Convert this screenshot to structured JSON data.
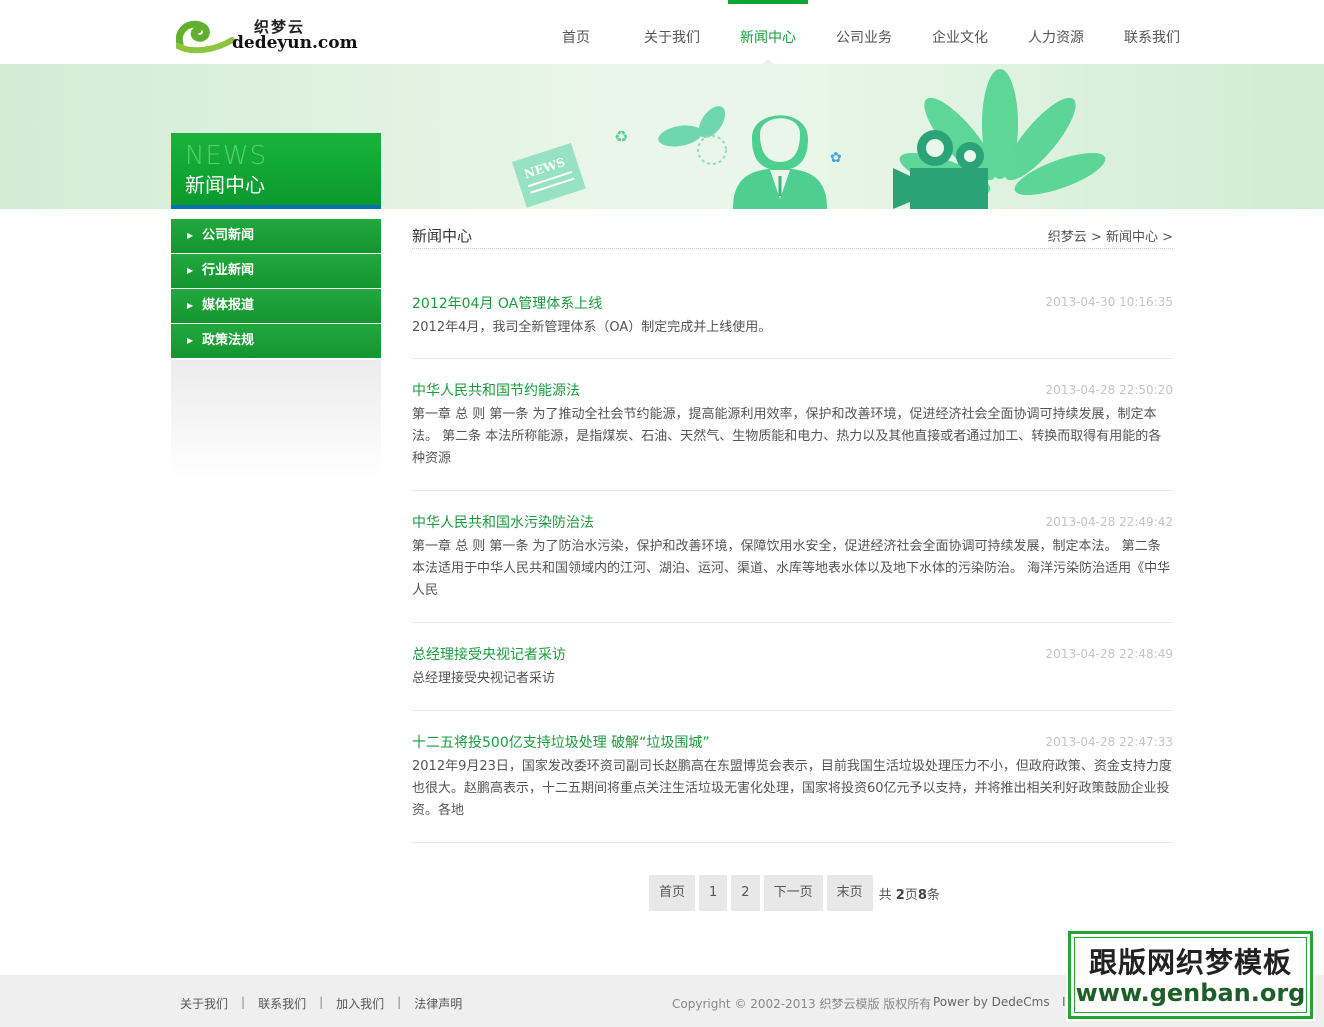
{
  "header": {
    "logo_cn": "织梦云",
    "logo_en": "dedeyun.com",
    "nav": [
      {
        "label": "首页",
        "active": false
      },
      {
        "label": "关于我们",
        "active": false
      },
      {
        "label": "新闻中心",
        "active": true
      },
      {
        "label": "公司业务",
        "active": false
      },
      {
        "label": "企业文化",
        "active": false
      },
      {
        "label": "人力资源",
        "active": false
      },
      {
        "label": "联系我们",
        "active": false
      }
    ]
  },
  "banner": {
    "en": "NEWS",
    "cn": "新闻中心",
    "paper_label": "NEWS"
  },
  "sidebar": {
    "items": [
      {
        "label": "公司新闻"
      },
      {
        "label": "行业新闻"
      },
      {
        "label": "媒体报道"
      },
      {
        "label": "政策法规"
      }
    ]
  },
  "content": {
    "title": "新闻中心",
    "breadcrumb": {
      "home": "织梦云",
      "sep": ">",
      "current": "新闻中心"
    }
  },
  "news": [
    {
      "title": "2012年04月 OA管理体系上线",
      "date": "2013-04-30 10:16:35",
      "desc": "2012年4月，我司全新管理体系（OA）制定完成并上线使用。"
    },
    {
      "title": "中华人民共和国节约能源法",
      "date": "2013-04-28 22:50:20",
      "desc": "第一章 总 则 第一条 为了推动全社会节约能源，提高能源利用效率，保护和改善环境，促进经济社会全面协调可持续发展，制定本法。 第二条 本法所称能源，是指煤炭、石油、天然气、生物质能和电力、热力以及其他直接或者通过加工、转换而取得有用能的各种资源"
    },
    {
      "title": "中华人民共和国水污染防治法",
      "date": "2013-04-28 22:49:42",
      "desc": "第一章 总 则 第一条 为了防治水污染，保护和改善环境，保障饮用水安全，促进经济社会全面协调可持续发展，制定本法。 第二条 本法适用于中华人民共和国领域内的江河、湖泊、运河、渠道、水库等地表水体以及地下水体的污染防治。 海洋污染防治适用《中华人民"
    },
    {
      "title": "总经理接受央视记者采访",
      "date": "2013-04-28 22:48:49",
      "desc": "总经理接受央视记者采访"
    },
    {
      "title": "十二五将投500亿支持垃圾处理 破解“垃圾围城”",
      "date": "2013-04-28 22:47:33",
      "desc": "2012年9月23日，国家发改委环资司副司长赵鹏高在东盟博览会表示，目前我国生活垃圾处理压力不小，但政府政策、资金支持力度也很大。赵鹏高表示，十二五期间将重点关注生活垃圾无害化处理，国家将投资60亿元予以支持，并将推出相关利好政策鼓励企业投资。各地"
    }
  ],
  "pager": {
    "first": "首页",
    "pages": [
      "1",
      "2"
    ],
    "next": "下一页",
    "last": "末页",
    "total_prefix": "共",
    "total_pages": "2",
    "total_mid": "页",
    "total_items": "8",
    "total_suffix": "条"
  },
  "footer": {
    "links": [
      "关于我们",
      "联系我们",
      "加入我们",
      "法律声明"
    ],
    "sep": "|",
    "copyright": "Copyright © 2002-2013 织梦云模版 版权所有",
    "power": "Power by DedeCms",
    "icp_partial": "I"
  },
  "watermark": {
    "line1": "跟版网织梦模板",
    "line2": "www.genban.org"
  },
  "colors": {
    "brand_green": "#12a234",
    "link_green": "#1a9c3c",
    "date_gray": "#c4c4c4",
    "sidebar_bar_blue": "#0b6fb0"
  }
}
